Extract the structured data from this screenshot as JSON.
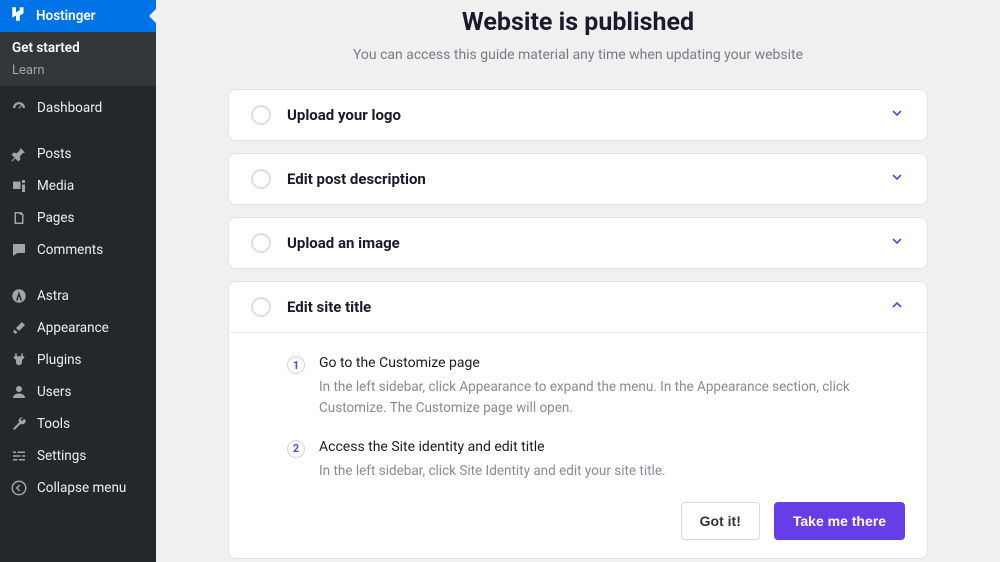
{
  "sidebar": {
    "brand": "Hostinger",
    "sub_active": "Get started",
    "sub_learn": "Learn",
    "items": [
      {
        "label": "Dashboard",
        "icon": "dashboard-icon"
      },
      {
        "label": "Posts",
        "icon": "pin-icon"
      },
      {
        "label": "Media",
        "icon": "media-icon"
      },
      {
        "label": "Pages",
        "icon": "pages-icon"
      },
      {
        "label": "Comments",
        "icon": "comments-icon"
      },
      {
        "label": "Astra",
        "icon": "astra-icon"
      },
      {
        "label": "Appearance",
        "icon": "brush-icon"
      },
      {
        "label": "Plugins",
        "icon": "plug-icon"
      },
      {
        "label": "Users",
        "icon": "user-icon"
      },
      {
        "label": "Tools",
        "icon": "wrench-icon"
      },
      {
        "label": "Settings",
        "icon": "sliders-icon"
      },
      {
        "label": "Collapse menu",
        "icon": "collapse-icon"
      }
    ]
  },
  "main": {
    "title": "Website is published",
    "subtitle": "You can access this guide material any time when updating your website",
    "tasks": [
      {
        "title": "Upload your logo",
        "expanded": false
      },
      {
        "title": "Edit post description",
        "expanded": false
      },
      {
        "title": "Upload an image",
        "expanded": false
      },
      {
        "title": "Edit site title",
        "expanded": true,
        "steps": [
          {
            "num": "1",
            "heading": "Go to the Customize page",
            "desc": "In the left sidebar, click Appearance to expand the menu. In the Appearance section, click Customize. The Customize page will open."
          },
          {
            "num": "2",
            "heading": "Access the Site identity and edit title",
            "desc": "In the left sidebar, click Site Identity and edit your site title."
          }
        ],
        "actions": {
          "secondary": "Got it!",
          "primary": "Take me there"
        }
      }
    ]
  }
}
